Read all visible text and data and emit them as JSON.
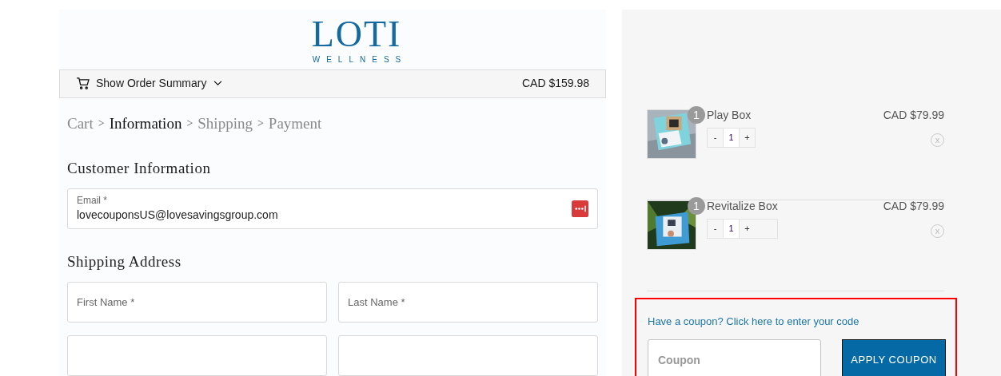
{
  "logo": {
    "name": "LOTI",
    "tagline": "WELLNESS"
  },
  "order_summary_bar": {
    "label": "Show Order Summary",
    "total": "CAD $159.98"
  },
  "breadcrumb": [
    {
      "label": "Cart",
      "selected": false
    },
    {
      "label": "Information",
      "selected": true
    },
    {
      "label": "Shipping",
      "selected": false
    },
    {
      "label": "Payment",
      "selected": false
    }
  ],
  "breadcrumb_separator": ">",
  "customer_information": {
    "heading": "Customer Information",
    "email_label": "Email *",
    "email_value": "lovecouponsUS@lovesavingsgroup.com"
  },
  "shipping_address": {
    "heading": "Shipping Address",
    "fields": [
      {
        "placeholder": "First Name *"
      },
      {
        "placeholder": "Last Name *"
      }
    ]
  },
  "cart_items": [
    {
      "name": "Play Box",
      "quantity_badge": "1",
      "price": "CAD $79.99",
      "minus": "-",
      "quantity": "1",
      "plus": "+",
      "remove": "x"
    },
    {
      "name": "Revitalize Box",
      "quantity_badge": "1",
      "price": "CAD $79.99",
      "minus": "-",
      "quantity": "1",
      "plus": "+",
      "remove": "x"
    }
  ],
  "coupon": {
    "highlighted": true,
    "prompt": "Have a coupon? Click here to enter your code",
    "placeholder": "Coupon",
    "button": "APPLY COUPON"
  }
}
